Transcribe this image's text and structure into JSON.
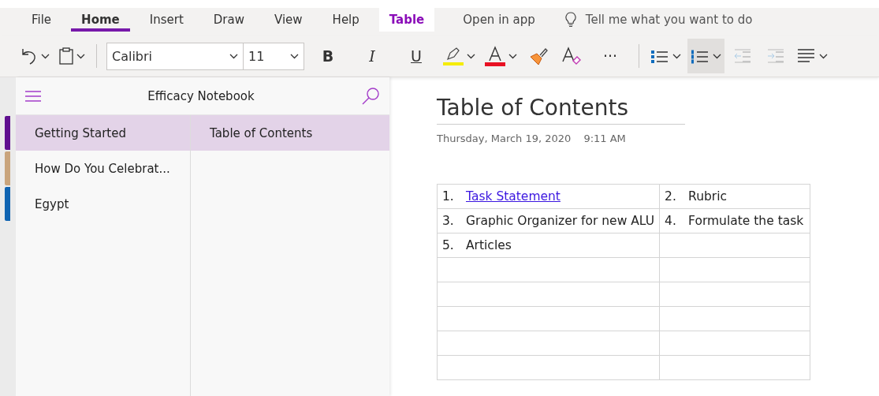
{
  "ribbon_tabs": [
    {
      "label": "File",
      "selected": false,
      "kind": "normal"
    },
    {
      "label": "Home",
      "selected": true,
      "kind": "normal"
    },
    {
      "label": "Insert",
      "selected": false,
      "kind": "normal"
    },
    {
      "label": "Draw",
      "selected": false,
      "kind": "normal"
    },
    {
      "label": "View",
      "selected": false,
      "kind": "normal"
    },
    {
      "label": "Help",
      "selected": false,
      "kind": "normal"
    },
    {
      "label": "Table",
      "selected": false,
      "kind": "contextual"
    }
  ],
  "open_in_app": "Open in app",
  "tell_me": {
    "placeholder": "Tell me what you want to do"
  },
  "toolbar": {
    "font": "Calibri",
    "size": "11",
    "bold": "B",
    "italic": "I",
    "underline": "U",
    "more": "···",
    "paragraph_buttons": [
      {
        "kind": "bullets",
        "selected": false,
        "disabled": false
      },
      {
        "kind": "numbering",
        "selected": true,
        "disabled": false
      },
      {
        "kind": "outdent",
        "selected": false,
        "disabled": true
      },
      {
        "kind": "indent",
        "selected": false,
        "disabled": true
      },
      {
        "kind": "align",
        "selected": false,
        "disabled": false
      }
    ]
  },
  "notebook": {
    "title": "Efficacy Notebook"
  },
  "sections": [
    {
      "label": "Getting Started",
      "selected": true,
      "color": "#5f0f8f"
    },
    {
      "label": "How Do You Celebrat...",
      "selected": false,
      "color": "#c9a47c"
    },
    {
      "label": "Egypt",
      "selected": false,
      "color": "#0f63b1"
    }
  ],
  "pages": [
    {
      "label": "Table of Contents",
      "selected": true
    }
  ],
  "page": {
    "title": "Table of Contents",
    "date": "Thursday, March 19, 2020",
    "time": "9:11 AM",
    "table": {
      "rows": [
        {
          "cells": [
            {
              "number": "1.",
              "text": "Task Statement",
              "link": true
            },
            {
              "number": "2.",
              "text": "Rubric",
              "link": false
            }
          ]
        },
        {
          "cells": [
            {
              "number": "3.",
              "text": "Graphic Organizer for new ALU",
              "link": false
            },
            {
              "number": "4.",
              "text": "Formulate the task",
              "link": false
            }
          ]
        },
        {
          "cells": [
            {
              "number": "5.",
              "text": "Articles",
              "link": false
            },
            {}
          ]
        },
        {
          "cells": [
            {},
            {}
          ]
        },
        {
          "cells": [
            {},
            {}
          ]
        },
        {
          "cells": [
            {},
            {}
          ]
        },
        {
          "cells": [
            {},
            {}
          ]
        },
        {
          "cells": [
            {},
            {}
          ]
        }
      ]
    }
  }
}
